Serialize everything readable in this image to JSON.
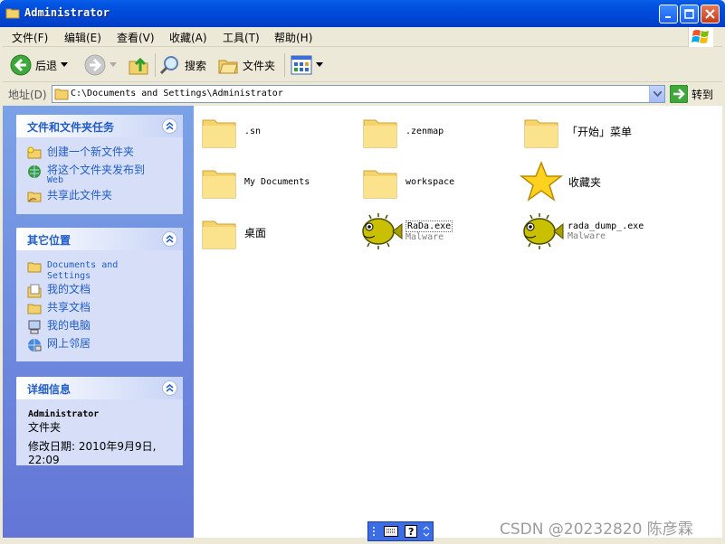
{
  "window": {
    "title": "Administrator"
  },
  "menu": [
    {
      "label": "文件(F)"
    },
    {
      "label": "编辑(E)"
    },
    {
      "label": "查看(V)"
    },
    {
      "label": "收藏(A)"
    },
    {
      "label": "工具(T)"
    },
    {
      "label": "帮助(H)"
    }
  ],
  "toolbar": {
    "back_label": "后退",
    "search_label": "搜索",
    "folders_label": "文件夹"
  },
  "address": {
    "label": "地址(D)",
    "value": "C:\\Documents and Settings\\Administrator",
    "go_label": "转到"
  },
  "sidebar": {
    "tasks": {
      "title": "文件和文件夹任务",
      "items": [
        {
          "label": "创建一个新文件夹",
          "icon": "new-folder-icon"
        },
        {
          "label": "将这个文件夹发布到",
          "label2": "Web",
          "icon": "publish-web-icon"
        },
        {
          "label": "共享此文件夹",
          "icon": "share-folder-icon"
        }
      ]
    },
    "places": {
      "title": "其它位置",
      "items": [
        {
          "label": "Documents and",
          "label2": "Settings",
          "icon": "folder-icon"
        },
        {
          "label": "我的文档",
          "icon": "my-documents-icon"
        },
        {
          "label": "共享文档",
          "icon": "shared-documents-icon"
        },
        {
          "label": "我的电脑",
          "icon": "my-computer-icon"
        },
        {
          "label": "网上邻居",
          "icon": "network-places-icon"
        }
      ]
    },
    "details": {
      "title": "详细信息",
      "name": "Administrator",
      "type": "文件夹",
      "modified_line1": "修改日期: 2010年9月9日,",
      "modified_line2": "22:09"
    }
  },
  "files": [
    {
      "name": ".sn",
      "icon": "folder-icon"
    },
    {
      "name": ".zenmap",
      "icon": "folder-icon"
    },
    {
      "name": "「开始」菜单",
      "icon": "folder-icon"
    },
    {
      "name": "My Documents",
      "icon": "folder-icon"
    },
    {
      "name": "workspace",
      "icon": "folder-icon"
    },
    {
      "name": "收藏夹",
      "icon": "star-icon"
    },
    {
      "name": "桌面",
      "icon": "folder-icon"
    },
    {
      "name": "RaDa.exe",
      "sub": "Malware",
      "icon": "pufferfish-icon"
    },
    {
      "name": "rada_dump_.exe",
      "sub": "Malware",
      "icon": "pufferfish-icon"
    }
  ],
  "watermark": "CSDN @20232820 陈彦霖",
  "colors": {
    "titlebar": "#0052e0",
    "sidebar": "#6f8fe0",
    "panel_title": "#215dc6"
  }
}
